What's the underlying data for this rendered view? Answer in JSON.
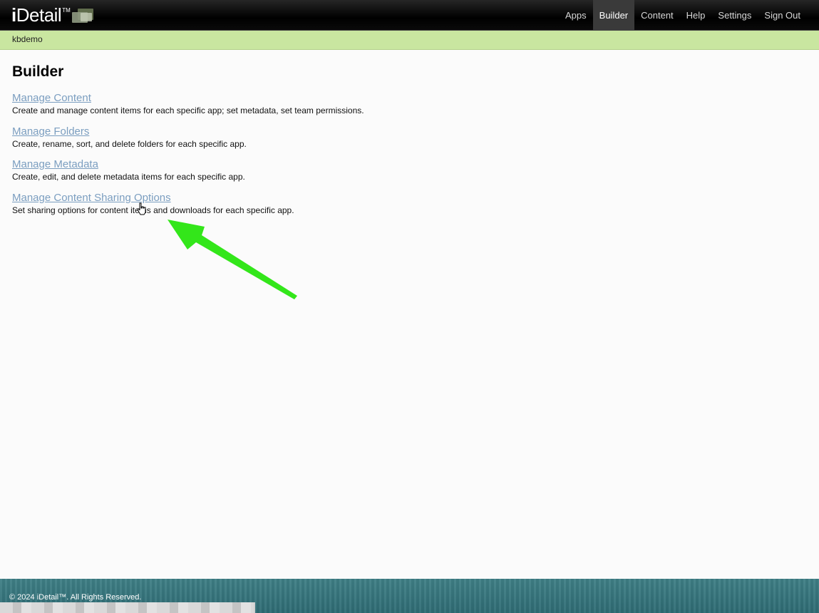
{
  "header": {
    "logo_text": "Detail",
    "logo_i": "i",
    "logo_tm": "TM",
    "nav": [
      {
        "label": "Apps"
      },
      {
        "label": "Builder",
        "active": true
      },
      {
        "label": "Content"
      },
      {
        "label": "Help"
      },
      {
        "label": "Settings"
      },
      {
        "label": "Sign Out"
      }
    ]
  },
  "subbar": {
    "username": "kbdemo"
  },
  "main": {
    "title": "Builder",
    "items": [
      {
        "link": "Manage Content",
        "description": "Create and manage content items for each specific app; set metadata, set team permissions."
      },
      {
        "link": "Manage Folders",
        "description": "Create, rename, sort, and delete folders for each specific app."
      },
      {
        "link": "Manage Metadata",
        "description": "Create, edit, and delete metadata items for each specific app."
      },
      {
        "link": "Manage Content Sharing Options",
        "description": "Set sharing options for content items and downloads for each specific app."
      }
    ]
  },
  "footer": {
    "copyright": "© 2024 iDetail™.  All Rights Reserved."
  },
  "colors": {
    "nav_bg": "#000000",
    "subbar_bg": "#c9e6a0",
    "link": "#7b9ec0",
    "annotation_arrow": "#33e61a",
    "footer_bg": "#3f7f86"
  }
}
